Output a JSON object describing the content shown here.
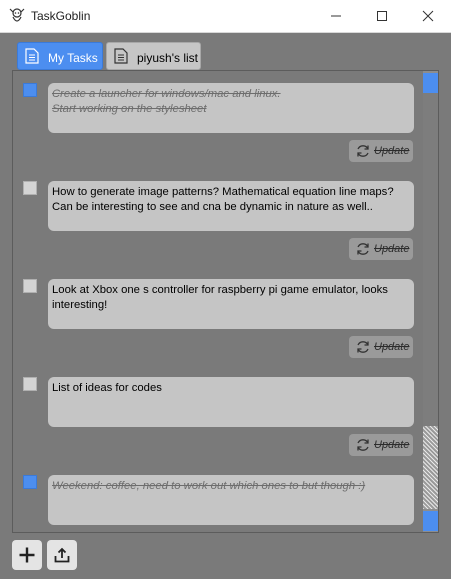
{
  "window": {
    "title": "TaskGoblin",
    "icons": {
      "app": "goblin-icon",
      "minimize": "minimize-icon",
      "maximize": "maximize-icon",
      "close": "close-icon"
    }
  },
  "tabs": [
    {
      "label": "My Tasks",
      "active": true,
      "icon": "document-icon"
    },
    {
      "label": "piyush's list",
      "active": false,
      "icon": "document-icon"
    }
  ],
  "tasks": [
    {
      "text": "Create a launcher for windows/mac and linux.\nStart working on the stylesheet",
      "done": true,
      "update_label": "Update"
    },
    {
      "text": "How to generate image patterns? Mathematical equation line maps? Can be interesting to see and cna be dynamic in nature as well..",
      "done": false,
      "update_label": "Update"
    },
    {
      "text": "Look at Xbox one s controller for raspberry pi game emulator, looks interesting!",
      "done": false,
      "update_label": "Update"
    },
    {
      "text": "List of ideas for codes",
      "done": false,
      "update_label": "Update"
    },
    {
      "text": "Weekend: coffee, need to work out which ones to but though :)",
      "done": true,
      "update_label": ""
    }
  ],
  "toolbar": {
    "add_icon": "plus-icon",
    "export_icon": "upload-icon"
  },
  "colors": {
    "accent": "#4c8ef0",
    "background": "#7a7a7a",
    "card": "#c5c5c5"
  }
}
